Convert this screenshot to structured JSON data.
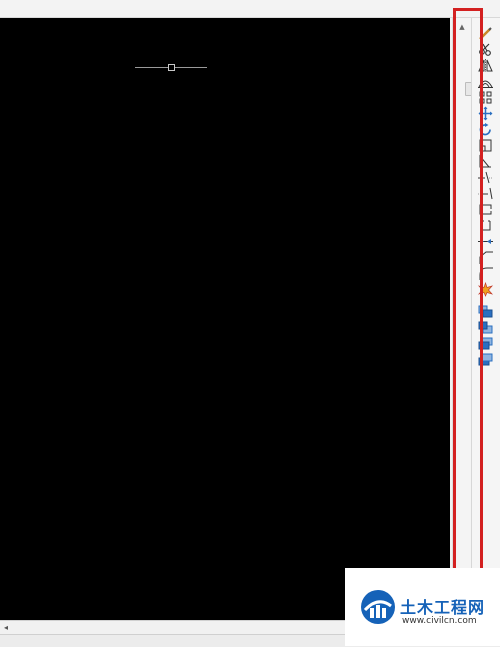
{
  "scrollbars": {
    "up_arrow": "▲",
    "left_arrow": "◂"
  },
  "modify_toolbar": {
    "tools": [
      {
        "id": "erase",
        "icon": "eraser-icon"
      },
      {
        "id": "copy",
        "icon": "copy-scissors-icon"
      },
      {
        "id": "mirror",
        "icon": "mirror-icon"
      },
      {
        "id": "offset",
        "icon": "offset-icon"
      },
      {
        "id": "array",
        "icon": "array-icon"
      },
      {
        "id": "move",
        "icon": "move-icon"
      },
      {
        "id": "rotate",
        "icon": "rotate-icon"
      },
      {
        "id": "scale",
        "icon": "scale-icon"
      },
      {
        "id": "stretch",
        "icon": "stretch-icon"
      },
      {
        "id": "trim",
        "icon": "trim-icon"
      },
      {
        "id": "extend",
        "icon": "extend-icon"
      },
      {
        "id": "break-at-point",
        "icon": "break-at-point-icon"
      },
      {
        "id": "break",
        "icon": "break-icon"
      },
      {
        "id": "join",
        "icon": "join-icon"
      },
      {
        "id": "chamfer",
        "icon": "chamfer-icon"
      },
      {
        "id": "fillet",
        "icon": "fillet-icon"
      },
      {
        "id": "explode",
        "icon": "explode-icon"
      },
      {
        "id": "draworder-front",
        "icon": "bring-to-front-icon"
      },
      {
        "id": "draworder-back",
        "icon": "send-to-back-icon"
      },
      {
        "id": "draworder-above",
        "icon": "bring-above-icon"
      },
      {
        "id": "draworder-under",
        "icon": "send-under-icon"
      }
    ]
  },
  "colors": {
    "canvas": "#000000",
    "highlight": "#d32020",
    "tool_blue": "#2a6fc0"
  },
  "watermark": {
    "title": "土木工程网",
    "url": "www.civilcn.com"
  }
}
